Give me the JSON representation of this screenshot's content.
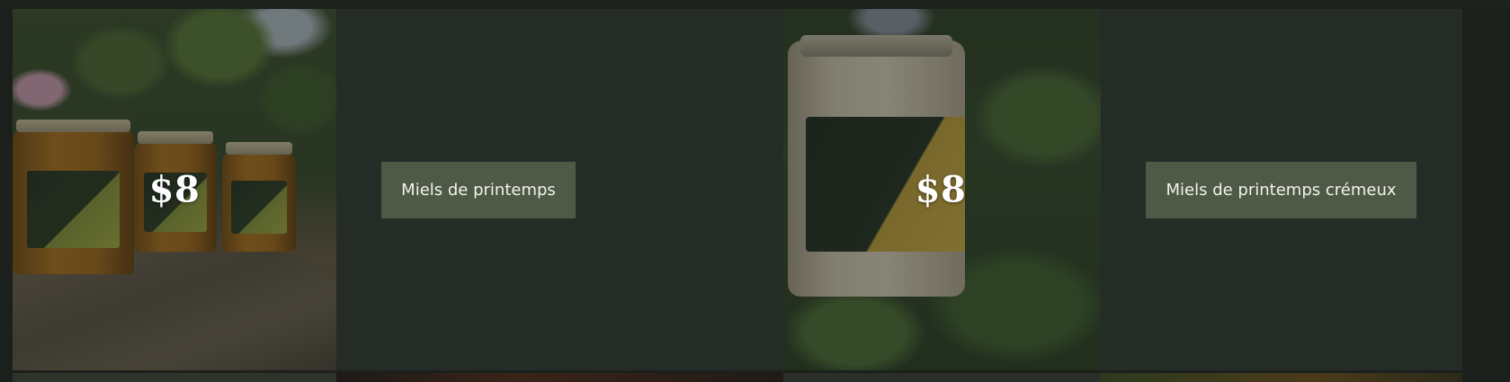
{
  "products": [
    {
      "price": "$8",
      "button_label": "Miels de printemps",
      "image_icon": "honey-jars-photo"
    },
    {
      "price": "$8",
      "button_label": "Miels de printemps crémeux",
      "image_icon": "creamy-honey-jar-photo"
    }
  ],
  "colors": {
    "background": "#1b201c",
    "panel": "#252b26",
    "button": "#4f5a46",
    "button_text": "#f2f2ee",
    "price_text": "#ffffff"
  }
}
